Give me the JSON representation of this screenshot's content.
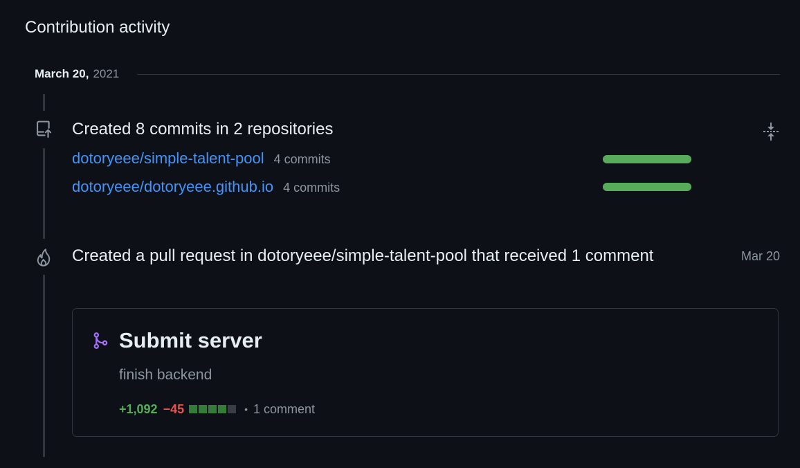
{
  "section": {
    "heading": "Contribution activity"
  },
  "date_group": {
    "month_day": "March 20,",
    "year": "2021"
  },
  "commits_item": {
    "icon": "repo-push-icon",
    "title": "Created 8 commits in 2 repositories",
    "collapse_icon": "fold-icon",
    "repos": [
      {
        "name": "dotoryeee/simple-talent-pool",
        "count": "4 commits",
        "share": 1.0
      },
      {
        "name": "dotoryeee/dotoryeee.github.io",
        "count": "4 commits",
        "share": 1.0
      }
    ]
  },
  "pr_item": {
    "icon": "flame-icon",
    "title": "Created a pull request in dotoryeee/simple-talent-pool that received 1 comment",
    "date": "Mar 20",
    "card": {
      "icon": "git-merge-icon",
      "title": "Submit server",
      "body": "finish backend",
      "additions": "+1,092",
      "deletions": "−45",
      "diffstat": [
        "add",
        "add",
        "add",
        "add",
        "neutral"
      ],
      "comments": "1 comment"
    }
  },
  "colors": {
    "background": "#0d1117",
    "link": "#4493f8",
    "addition": "#57ab5a",
    "deletion": "#e5534b",
    "muted": "#8d96a0",
    "merged": "#a371f7"
  }
}
